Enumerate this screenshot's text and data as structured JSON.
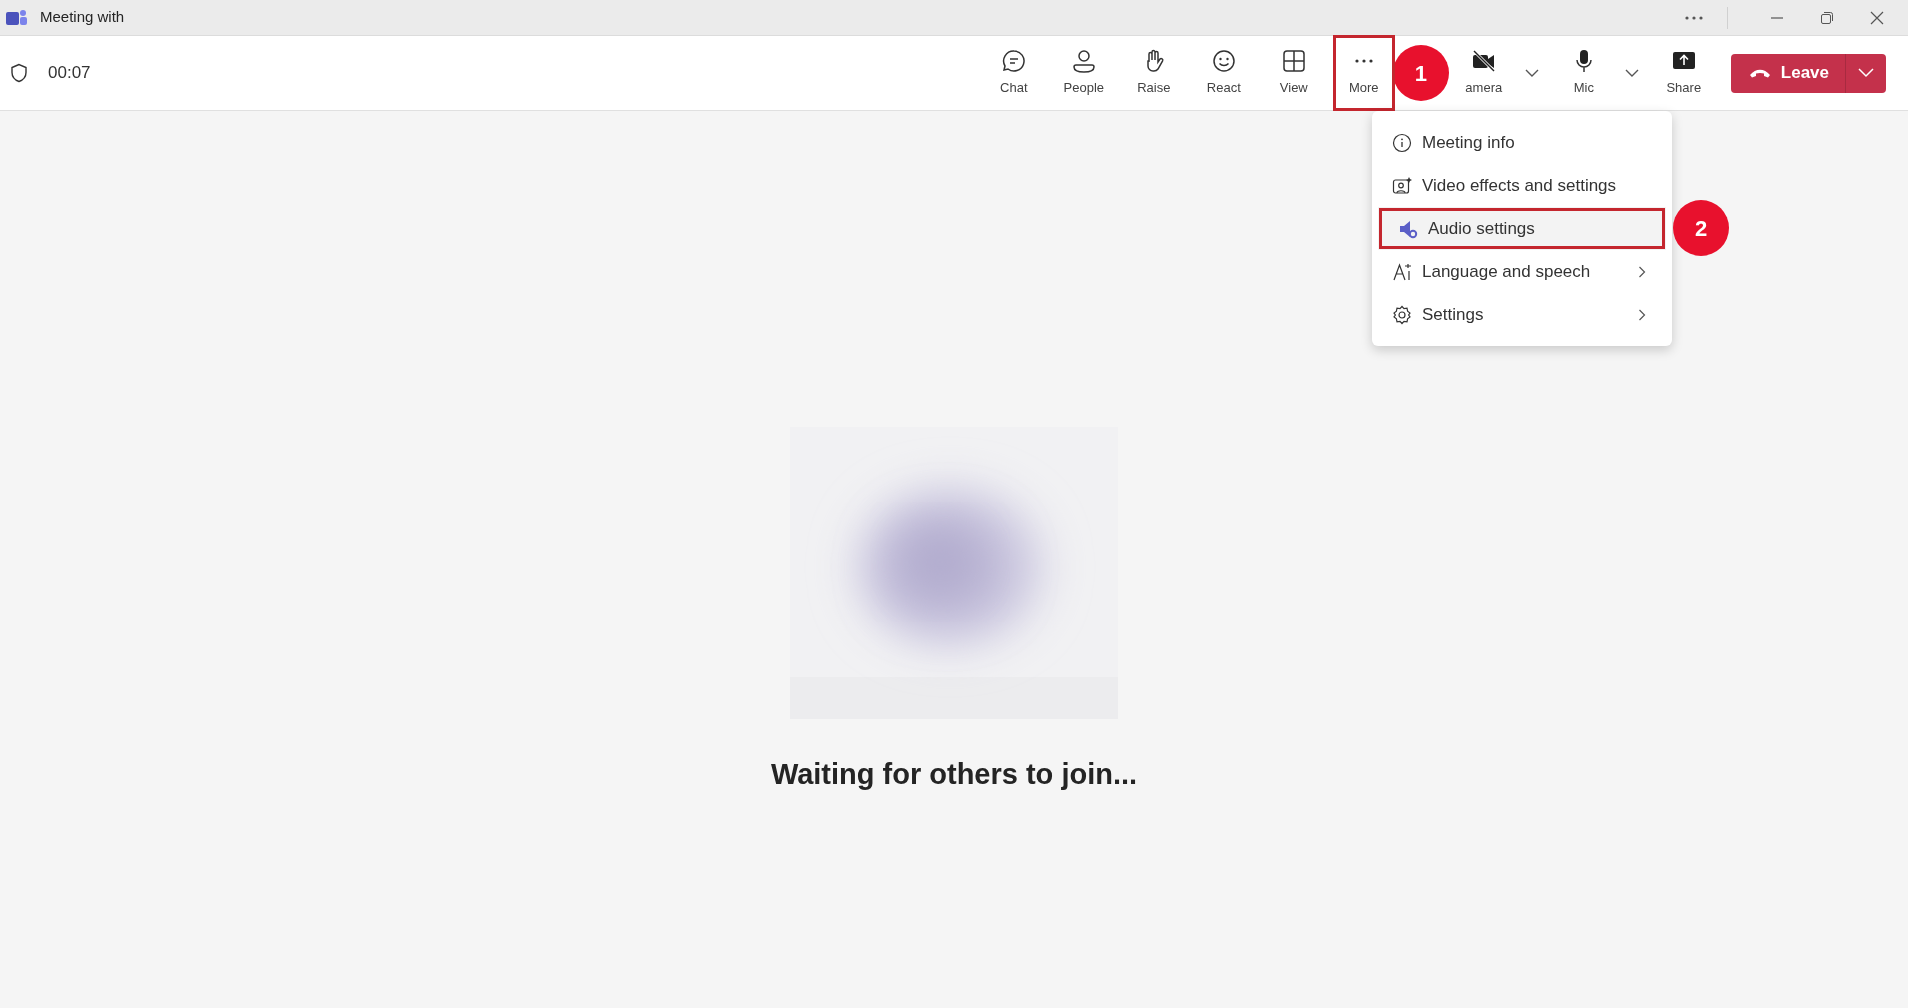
{
  "window": {
    "title": "Meeting with"
  },
  "toolbar": {
    "timer": "00:07",
    "buttons": [
      {
        "label": "Chat",
        "marked": false
      },
      {
        "label": "People",
        "marked": false
      },
      {
        "label": "Raise",
        "marked": false
      },
      {
        "label": "React",
        "marked": false
      },
      {
        "label": "View",
        "marked": false
      },
      {
        "label": "More",
        "marked": true
      },
      {
        "label": "amera",
        "marked": false,
        "dropdown": true
      },
      {
        "label": "Mic",
        "marked": false,
        "dropdown": true
      },
      {
        "label": "Share",
        "marked": false
      }
    ],
    "leave_button": "Leave"
  },
  "menu": {
    "items": [
      {
        "label": "Meeting info",
        "submenu": false,
        "marked": false
      },
      {
        "label": "Video effects and settings",
        "submenu": false,
        "marked": false
      },
      {
        "label": "Audio settings",
        "submenu": false,
        "marked": true
      },
      {
        "label": "Language and speech",
        "submenu": true,
        "marked": false
      },
      {
        "label": "Settings",
        "submenu": true,
        "marked": false
      }
    ]
  },
  "step_badges": [
    "1",
    "2"
  ],
  "status_message": "Waiting for others to join..."
}
